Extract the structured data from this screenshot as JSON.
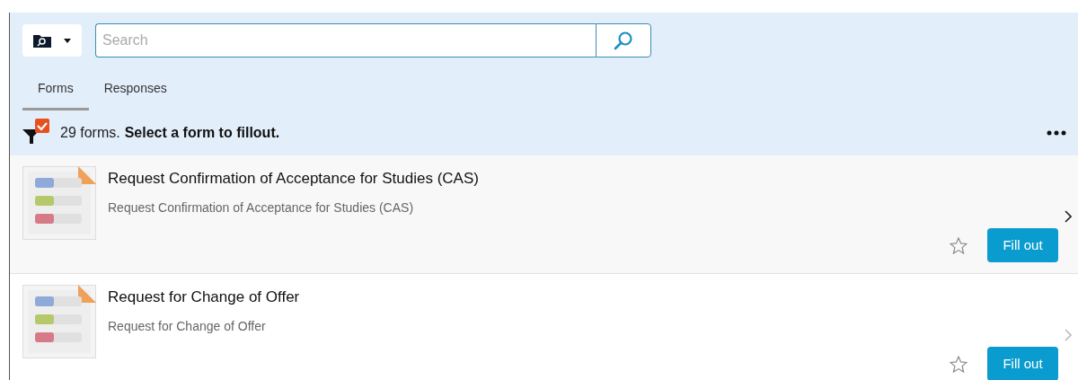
{
  "search": {
    "placeholder": "Search"
  },
  "tabs": [
    {
      "label": "Forms",
      "selected": true
    },
    {
      "label": "Responses",
      "selected": false
    }
  ],
  "summary": {
    "count": "29 forms.",
    "hint": "Select a form to fillout.",
    "filter_active": true
  },
  "forms": [
    {
      "title": "Request Confirmation of Acceptance for Studies (CAS)",
      "description": "Request Confirmation of Acceptance for Studies (CAS)",
      "highlighted": true,
      "starred": false,
      "action": "Fill out"
    },
    {
      "title": "Request for Change of Offer",
      "description": "Request for Change of Offer",
      "highlighted": false,
      "starred": false,
      "action": "Fill out"
    }
  ]
}
